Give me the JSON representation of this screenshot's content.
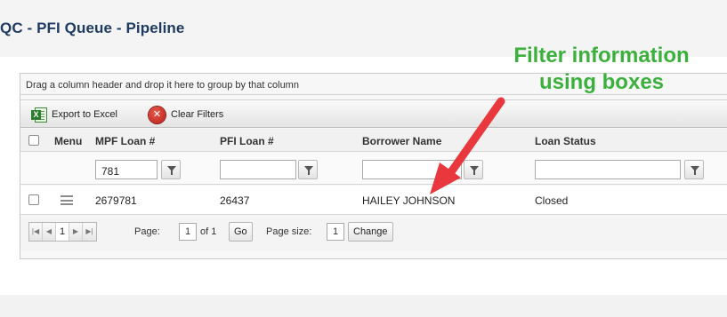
{
  "page_title": "QC - PFI Queue - Pipeline",
  "group_panel_text": "Drag a column header and drop it here to group by that column",
  "toolbar": {
    "export_label": "Export to Excel",
    "clear_label": "Clear Filters"
  },
  "columns": {
    "menu": "Menu",
    "mpf_loan": "MPF Loan #",
    "pfi_loan": "PFI Loan #",
    "borrower": "Borrower Name",
    "loan_status": "Loan Status"
  },
  "filters": {
    "mpf_loan": "781",
    "pfi_loan": "",
    "borrower": "",
    "loan_status": ""
  },
  "rows": [
    {
      "mpf_loan": "2679781",
      "pfi_loan": "26437",
      "borrower": "HAILEY JOHNSON",
      "loan_status": "Closed"
    }
  ],
  "pager": {
    "current_page": "1",
    "page_label": "Page:",
    "page_value": "1",
    "of_label": "of 1",
    "go_label": "Go",
    "size_label": "Page size:",
    "size_value": "1",
    "change_label": "Change"
  },
  "annotation": {
    "line1": "Filter information",
    "line2": "using boxes",
    "color": "#3cb03c",
    "arrow_color": "#e8373d"
  },
  "icons": [
    "excel-icon",
    "clear-filter-icon",
    "menu-icon",
    "funnel-icon",
    "first-page-icon",
    "prev-page-icon",
    "next-page-icon",
    "last-page-icon"
  ]
}
